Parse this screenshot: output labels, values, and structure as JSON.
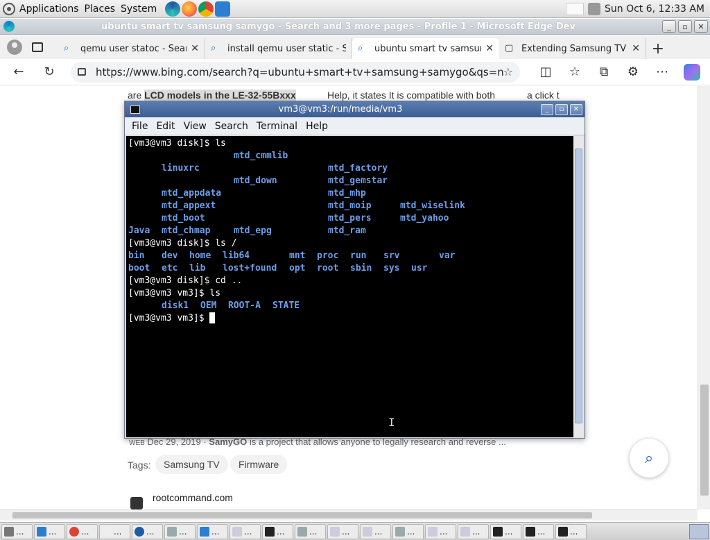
{
  "top_panel": {
    "menus": [
      "Applications",
      "Places",
      "System"
    ],
    "clock": "Sun Oct  6, 12:33 AM"
  },
  "window": {
    "title": "ubuntu smart tv samsung samygo - Search and 3 more pages - Profile 1 - Microsoft Edge Dev"
  },
  "tabs": [
    {
      "label": "qemu user statoc - Search"
    },
    {
      "label": "install qemu user static - S"
    },
    {
      "label": "ubuntu smart tv samsung"
    },
    {
      "label": "Extending Samsung TV fea"
    }
  ],
  "address_bar": {
    "url": "https://www.bing.com/search?q=ubuntu+smart+tv+samsung+samygo&qs=n&f..."
  },
  "page": {
    "top_text_pre": "are ",
    "top_text_hl": "LCD models in the LE-32-55Bxxx",
    "top_text_mid": "Help, it states It is compatible with both",
    "top_text_right": "a click t",
    "result_meta_prefix": "WEB",
    "result_meta_date": "Dec 29, 2019 · ",
    "result_meta_bold": "SamyGO",
    "result_meta_rest": " is a project that allows anyone to legally research and reverse ...",
    "tags_label": "Tags:",
    "tags": [
      "Samsung TV",
      "Firmware"
    ],
    "next_site": "rootcommand.com"
  },
  "terminal": {
    "title": "vm3@vm3:/run/media/vm3",
    "menu": [
      "File",
      "Edit",
      "View",
      "Search",
      "Terminal",
      "Help"
    ],
    "prompt1": "[vm3@vm3 disk]$ ls",
    "ls1": [
      [
        "mtd_cmmlib"
      ],
      [
        "linuxrc",
        "mtd_factory"
      ],
      [
        "mtd_down",
        "mtd_gemstar"
      ],
      [
        "mtd_appdata",
        "mtd_mhp"
      ],
      [
        "mtd_appext",
        "mtd_moip",
        "mtd_wiselink"
      ],
      [
        "mtd_boot",
        "mtd_pers",
        "mtd_yahoo"
      ],
      [
        "Java",
        "mtd_chmap",
        "mtd_epg",
        "mtd_ram"
      ]
    ],
    "prompt2": "[vm3@vm3 disk]$ ls /",
    "ls2_row1": [
      "bin",
      "dev",
      "home",
      "lib64",
      "mnt",
      "proc",
      "run",
      "srv",
      "var"
    ],
    "ls2_row2": [
      "boot",
      "etc",
      "lib",
      "lost+found",
      "opt",
      "root",
      "sbin",
      "sys",
      "usr"
    ],
    "prompt3": "[vm3@vm3 disk]$ cd ..",
    "prompt4": "[vm3@vm3 vm3]$ ls",
    "ls3": [
      "disk1",
      "OEM",
      "ROOT-A",
      "STATE"
    ],
    "prompt5": "[vm3@vm3 vm3]$ "
  },
  "taskbar": {
    "ellipsis": "..."
  },
  "colors": {
    "terminal_bg": "#000000",
    "dir_blue": "#6c9ee8",
    "sticky_green": "#4e9a06",
    "title_blue": "#3c5d92"
  }
}
